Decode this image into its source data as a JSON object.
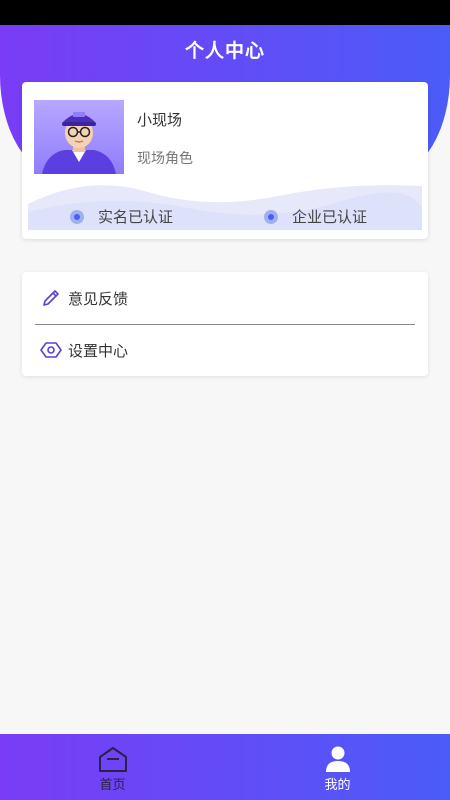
{
  "header": {
    "title": "个人中心"
  },
  "profile": {
    "name": "小现场",
    "role": "现场角色",
    "badges": [
      "实名已认证",
      "企业已认证"
    ]
  },
  "menu": [
    {
      "label": "意见反馈",
      "icon": "pencil-icon"
    },
    {
      "label": "设置中心",
      "icon": "hexagon-settings-icon"
    }
  ],
  "tabbar": [
    {
      "label": "首页",
      "icon": "home-icon",
      "active": false
    },
    {
      "label": "我的",
      "icon": "person-icon",
      "active": true
    }
  ],
  "colors": {
    "gradient_start": "#7a3cf6",
    "gradient_end": "#4b5cf8"
  }
}
